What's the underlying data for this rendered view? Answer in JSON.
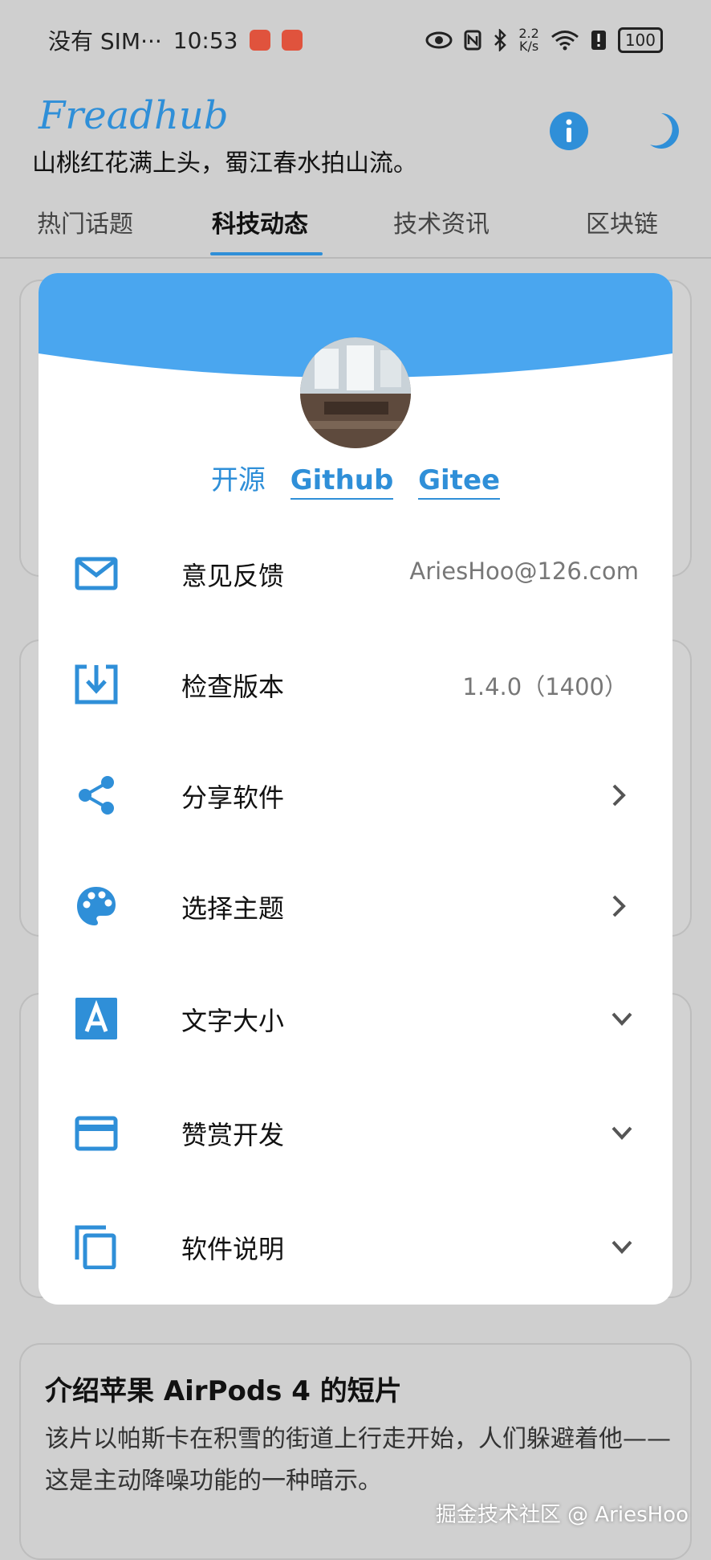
{
  "status_bar": {
    "carrier": "没有 SIM···",
    "time": "10:53",
    "net_speed_value": "2.2",
    "net_speed_unit": "K/s",
    "battery": "100"
  },
  "header": {
    "title": "Freadhub",
    "subtitle": "山桃红花满上头，蜀江春水拍山流。"
  },
  "tabs": [
    {
      "label": "热门话题"
    },
    {
      "label": "科技动态"
    },
    {
      "label": "技术资讯"
    },
    {
      "label": "区块链"
    }
  ],
  "modal": {
    "links": {
      "open_source": "开源",
      "github": "Github",
      "gitee": "Gitee"
    },
    "menu": [
      {
        "label": "意见反馈",
        "value": "AriesHoo@126.com",
        "icon": "mail-icon"
      },
      {
        "label": "检查版本",
        "value": "1.4.0（1400）",
        "icon": "download-icon"
      },
      {
        "label": "分享软件",
        "icon": "share-icon"
      },
      {
        "label": "选择主题",
        "icon": "palette-icon"
      },
      {
        "label": "文字大小",
        "icon": "font-icon"
      },
      {
        "label": "赞赏开发",
        "icon": "card-icon"
      },
      {
        "label": "软件说明",
        "icon": "copy-icon"
      }
    ]
  },
  "article": {
    "title": "介绍苹果 AirPods 4 的短片",
    "body": "该片以帕斯卡在积雪的街道上行走开始，人们躲避着他——这是主动降噪功能的一种暗示。"
  },
  "watermark": "掘金技术社区 @ AriesHoo",
  "colors": {
    "accent": "#2f8fd8",
    "wave": "#4aa6ef"
  }
}
